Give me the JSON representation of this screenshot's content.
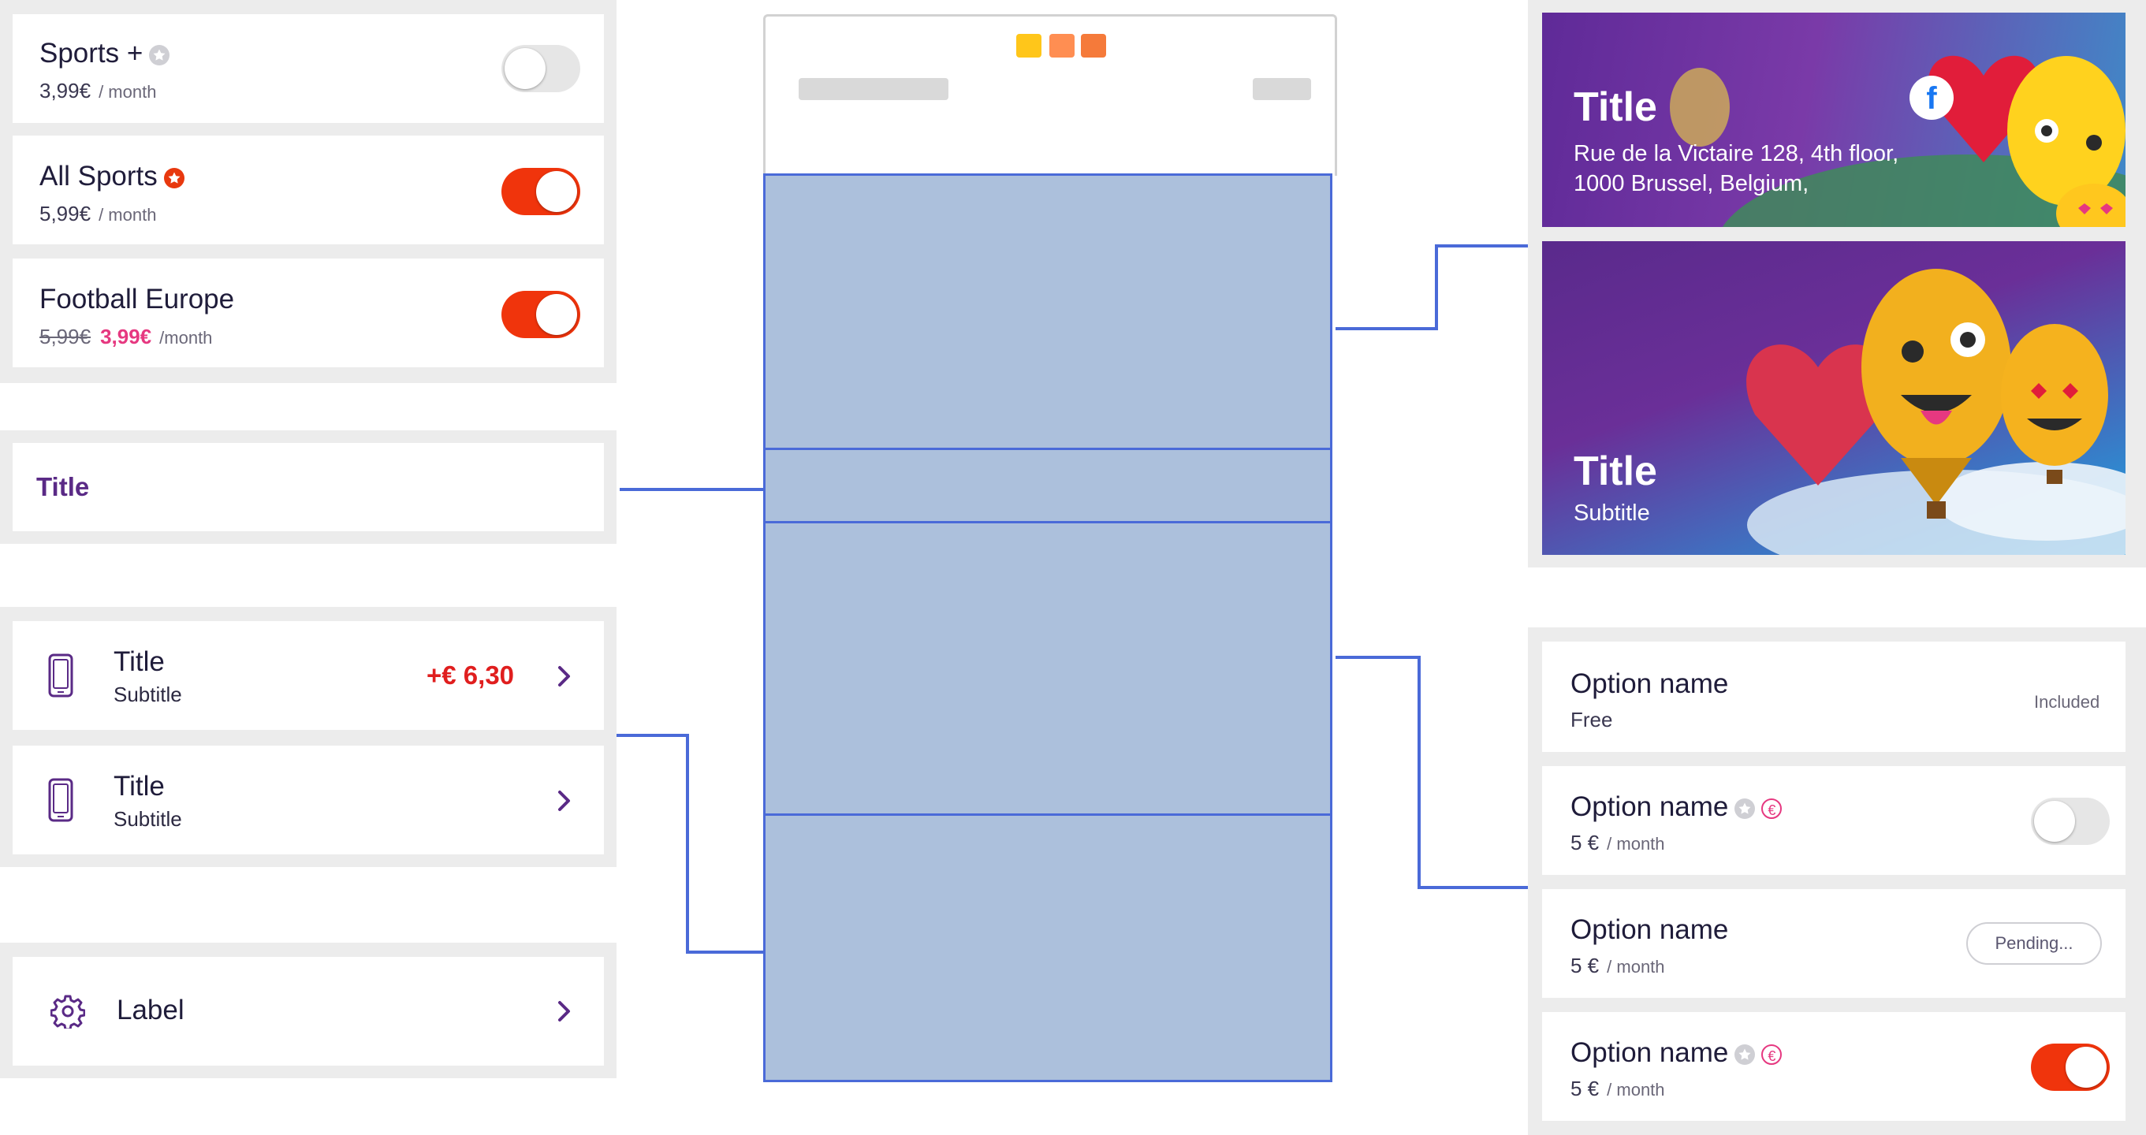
{
  "sports_options": [
    {
      "name": "Sports +",
      "price": "3,99€",
      "unit": "/ month",
      "badge": "grey",
      "toggle": "off"
    },
    {
      "name": "All Sports",
      "price": "5,99€",
      "unit": "/ month",
      "badge": "red",
      "toggle": "on"
    },
    {
      "name": "Football Europe",
      "old_price": "5,99€",
      "promo_price": "3,99€",
      "unit": "/month",
      "toggle": "on"
    }
  ],
  "section_title": "Title",
  "list_rows": [
    {
      "title": "Title",
      "subtitle": "Subtitle",
      "amount": "+€ 6,30"
    },
    {
      "title": "Title",
      "subtitle": "Subtitle"
    }
  ],
  "settings_row": {
    "label": "Label"
  },
  "banners": [
    {
      "title": "Title",
      "address_line1": "Rue de la Victaire 128, 4th floor,",
      "address_line2": "1000 Brussel, Belgium,"
    },
    {
      "title": "Title",
      "subtitle": "Subtitle"
    }
  ],
  "options": [
    {
      "name": "Option name",
      "price": "Free",
      "status": "Included"
    },
    {
      "name": "Option name",
      "price": "5 €",
      "unit": "/ month",
      "toggle": "off"
    },
    {
      "name": "Option name",
      "price": "5 €",
      "unit": "/ month",
      "status": "Pending..."
    },
    {
      "name": "Option name",
      "price": "5 €",
      "unit": "/ month",
      "toggle": "on"
    }
  ],
  "colors": {
    "toggle_on": "#f0340c",
    "toggle_off": "#e6e6e6",
    "accent_purple": "#5a2a86",
    "promo_pink": "#e63880",
    "amount_red": "#e01e1e",
    "section_fill": "#acc0dc",
    "connector_blue": "#4a6ad8",
    "window_dots": [
      "#ffc61a",
      "#ff8e52",
      "#f57a3a"
    ]
  },
  "icons": [
    "star-icon",
    "euro-icon",
    "phone-icon",
    "gear-icon",
    "chevron-right-icon",
    "facebook-icon"
  ]
}
